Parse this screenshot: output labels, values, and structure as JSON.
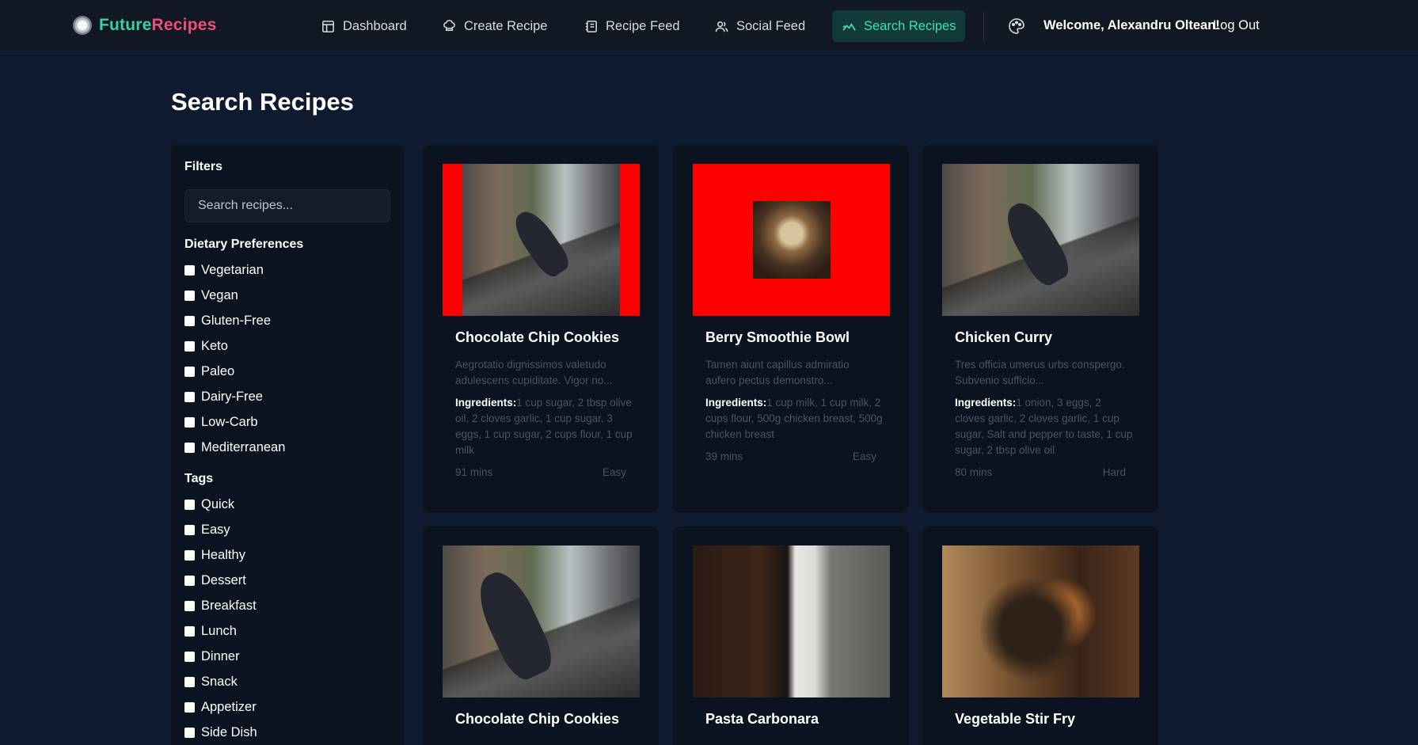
{
  "brand": {
    "part1": "Future",
    "part2": "Recipes"
  },
  "nav": {
    "items": [
      {
        "label": "Dashboard",
        "icon": "dashboard-icon"
      },
      {
        "label": "Create Recipe",
        "icon": "chef-hat-icon"
      },
      {
        "label": "Recipe Feed",
        "icon": "notebook-icon"
      },
      {
        "label": "Social Feed",
        "icon": "users-icon"
      },
      {
        "label": "Search Recipes",
        "icon": "search-trend-icon",
        "active": true
      }
    ],
    "welcome": "Welcome, Alexandru Oltean!",
    "logout": "Log Out"
  },
  "page": {
    "title": "Search Recipes"
  },
  "filters": {
    "title": "Filters",
    "search_placeholder": "Search recipes...",
    "dietary_title": "Dietary Preferences",
    "dietary": [
      "Vegetarian",
      "Vegan",
      "Gluten-Free",
      "Keto",
      "Paleo",
      "Dairy-Free",
      "Low-Carb",
      "Mediterranean"
    ],
    "tags_title": "Tags",
    "tags": [
      "Quick",
      "Easy",
      "Healthy",
      "Dessert",
      "Breakfast",
      "Lunch",
      "Dinner",
      "Snack",
      "Appetizer",
      "Side Dish"
    ]
  },
  "recipes": [
    {
      "title": "Chocolate Chip Cookies",
      "description": "Aegrotatio dignissimos valetudo adulescens cupiditate. Vigor no...",
      "ingredients_label": "Ingredients:",
      "ingredients": "1 cup sugar, 2 tbsp olive oil, 2 cloves garlic, 1 cup sugar, 3 eggs, 1 cup sugar, 2 cups flour, 1 cup milk",
      "time": "91 mins",
      "difficulty": "Easy"
    },
    {
      "title": "Berry Smoothie Bowl",
      "description": "Tamen aiunt capillus admiratio aufero pectus demonstro...",
      "ingredients_label": "Ingredients:",
      "ingredients": "1 cup milk, 1 cup milk, 2 cups flour, 500g chicken breast, 500g chicken breast",
      "time": "39 mins",
      "difficulty": "Easy"
    },
    {
      "title": "Chicken Curry",
      "description": "Tres officia umerus urbs conspergo. Subvenio sufficio...",
      "ingredients_label": "Ingredients:",
      "ingredients": "1 onion, 3 eggs, 2 cloves garlic, 2 cloves garlic, 1 cup sugar, Salt and pepper to taste, 1 cup sugar, 2 tbsp olive oil",
      "time": "80 mins",
      "difficulty": "Hard"
    },
    {
      "title": "Chocolate Chip Cookies"
    },
    {
      "title": "Pasta Carbonara"
    },
    {
      "title": "Vegetable Stir Fry"
    }
  ],
  "colors": {
    "accent": "#34d3a6",
    "brand_pink": "#ef4e7b",
    "background": "#0f1a2e",
    "panel": "#0b1220"
  }
}
